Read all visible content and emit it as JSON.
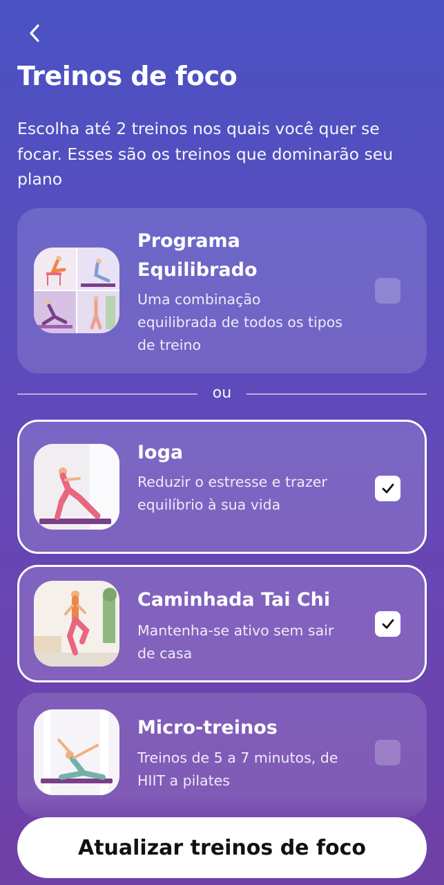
{
  "header": {
    "back_icon": "chevron-left-icon",
    "title": "Treinos de foco",
    "subtitle": "Escolha até 2 treinos nos quais você quer se focar. Esses são os treinos que dominarão seu plano"
  },
  "cards": [
    {
      "title": "Programa Equilibrado",
      "description": "Uma combinação equilibrada de todos os tipos de treino",
      "checked": false
    },
    {
      "title": "Ioga",
      "description": "Reduzir o estresse e trazer equilíbrio à sua vida",
      "checked": true
    },
    {
      "title": "Caminhada Tai Chi",
      "description": "Mantenha-se ativo sem sair de casa",
      "checked": true
    },
    {
      "title": "Micro-treinos",
      "description": "Treinos de 5 a 7 minutos, de HIIT a pilates",
      "checked": false
    }
  ],
  "divider_label": "ou",
  "primary_button": "Atualizar treinos de foco",
  "colors": {
    "background_top": "#4a52c4",
    "background_bottom": "#6e40a8",
    "accent_pink": "#e8677f",
    "accent_orange": "#f0844a",
    "mat_purple": "#7a3f86"
  }
}
